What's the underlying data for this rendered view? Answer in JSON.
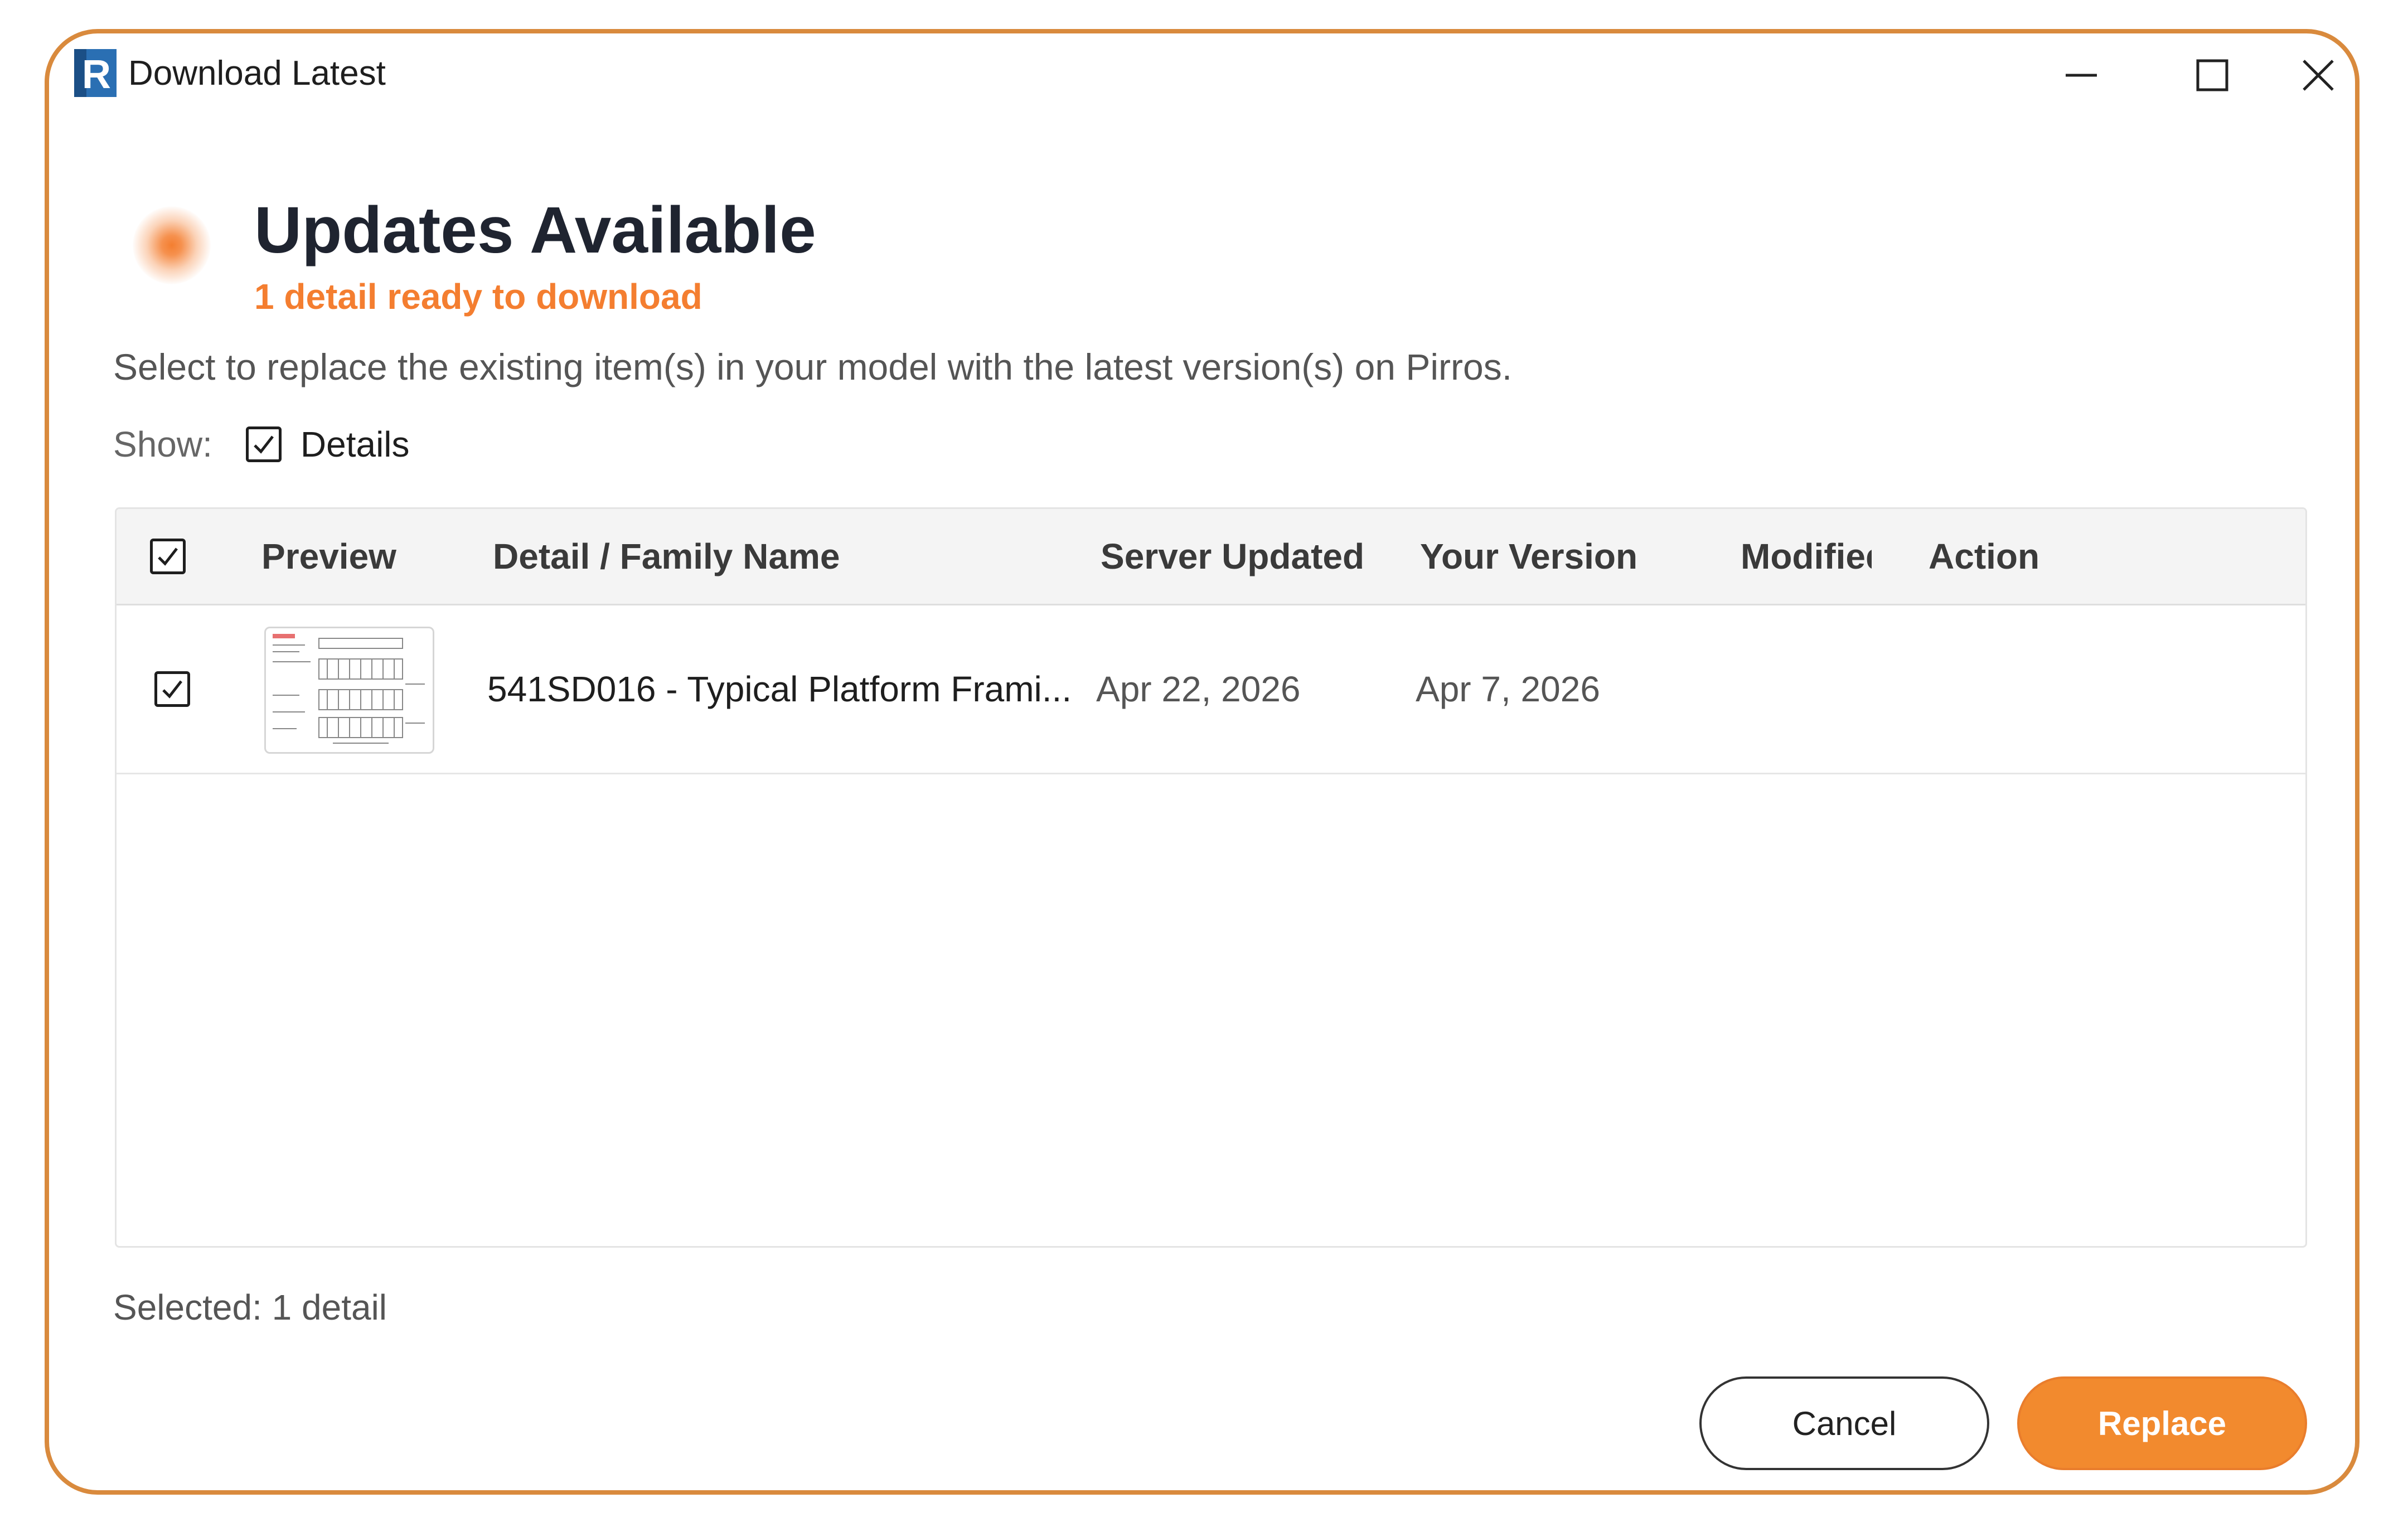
{
  "window": {
    "title": "Download Latest",
    "app_icon": "revit-r-icon",
    "controls": [
      "minimize-icon",
      "maximize-icon",
      "close-icon"
    ]
  },
  "header": {
    "title": "Updates Available",
    "subtitle": "1 detail ready to download",
    "status_dot_color": "#F47E30"
  },
  "description": "Select to replace the existing item(s) in your model with the latest version(s) on Pirros.",
  "filter": {
    "show_label": "Show:",
    "details_label": "Details",
    "details_checked": true
  },
  "table": {
    "columns": {
      "select_all_checked": true,
      "preview": "Preview",
      "name": "Detail / Family Name",
      "server_updated": "Server Updated",
      "your_version": "Your Version",
      "modified": "Modified",
      "action": "Action"
    },
    "rows": [
      {
        "checked": true,
        "name": "541SD016 - Typical Platform Frami...",
        "server_updated": "Apr 22, 2026",
        "your_version": "Apr 7, 2026",
        "modified": "",
        "action": ""
      }
    ]
  },
  "footer": {
    "selected_text": "Selected: 1 detail",
    "cancel_label": "Cancel",
    "replace_label": "Replace"
  },
  "colors": {
    "accent": "#F28A2E",
    "window_border": "#D98A3D"
  }
}
